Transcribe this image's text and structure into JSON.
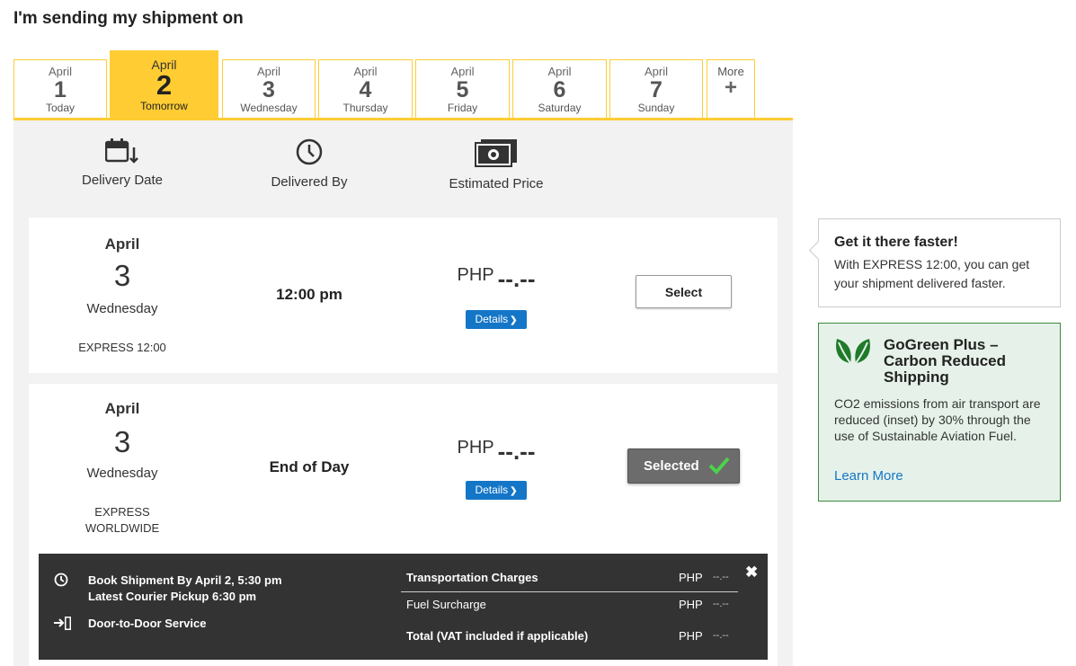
{
  "heading": "I'm sending my shipment on",
  "tabs": [
    {
      "month": "April",
      "day": "1",
      "weekday": "Today"
    },
    {
      "month": "April",
      "day": "2",
      "weekday": "Tomorrow"
    },
    {
      "month": "April",
      "day": "3",
      "weekday": "Wednesday"
    },
    {
      "month": "April",
      "day": "4",
      "weekday": "Thursday"
    },
    {
      "month": "April",
      "day": "5",
      "weekday": "Friday"
    },
    {
      "month": "April",
      "day": "6",
      "weekday": "Saturday"
    },
    {
      "month": "April",
      "day": "7",
      "weekday": "Sunday"
    }
  ],
  "more_tab": {
    "label": "More",
    "symbol": "+"
  },
  "columns": {
    "delivery_date": "Delivery Date",
    "delivered_by": "Delivered By",
    "estimated_price": "Estimated Price"
  },
  "options": [
    {
      "month": "April",
      "day": "3",
      "weekday": "Wednesday",
      "product": "EXPRESS 12:00",
      "time": "12:00 pm",
      "currency": "PHP",
      "amount": "--.--",
      "details_label": "Details",
      "button_label": "Select"
    },
    {
      "month": "April",
      "day": "3",
      "weekday": "Wednesday",
      "product_line1": "EXPRESS",
      "product_line2": "WORLDWIDE",
      "time": "End of Day",
      "currency": "PHP",
      "amount": "--.--",
      "details_label": "Details",
      "button_label": "Selected"
    }
  ],
  "details_panel": {
    "book_by": "Book Shipment By April 2, 5:30 pm",
    "pickup": "Latest Courier Pickup 6:30 pm",
    "service": "Door-to-Door Service",
    "charges": [
      {
        "label": "Transportation Charges",
        "currency": "PHP",
        "value": "--.--"
      },
      {
        "label": "Fuel Surcharge",
        "currency": "PHP",
        "value": "--.--"
      },
      {
        "label": "Total (VAT included if applicable)",
        "currency": "PHP",
        "value": "--.--"
      }
    ]
  },
  "promo_faster": {
    "title": "Get it there faster!",
    "body": "With EXPRESS 12:00, you can get your shipment delivered faster."
  },
  "promo_green": {
    "title": "GoGreen Plus – Carbon Reduced Shipping",
    "body": "CO2 emissions from air transport are reduced (inset) by 30% through the use of Sustainable Aviation Fuel.",
    "link": "Learn More"
  },
  "colors": {
    "accent": "#ffcc33",
    "blue": "#1476c7",
    "dark_panel": "#333333",
    "green": "#2e7d32"
  }
}
